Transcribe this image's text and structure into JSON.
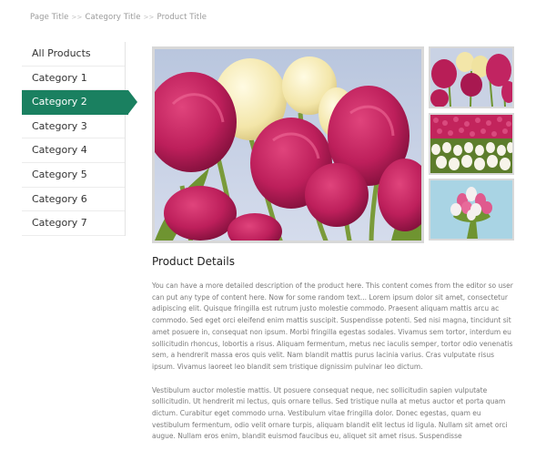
{
  "breadcrumb": {
    "items": [
      "Page Title",
      "Category Title",
      "Product Title"
    ],
    "separator": ">>"
  },
  "sidebar": {
    "items": [
      {
        "label": "All Products",
        "active": false
      },
      {
        "label": "Category 1",
        "active": false
      },
      {
        "label": "Category 2",
        "active": true
      },
      {
        "label": "Category 3",
        "active": false
      },
      {
        "label": "Category 4",
        "active": false
      },
      {
        "label": "Category 5",
        "active": false
      },
      {
        "label": "Category 6",
        "active": false
      },
      {
        "label": "Category 7",
        "active": false
      }
    ],
    "accent_color": "#1a8060"
  },
  "gallery": {
    "main_image": "tulips-closeup-image",
    "thumbnails": [
      "tulips-field-thumbnail",
      "tulips-rows-thumbnail",
      "tulips-bouquet-thumbnail"
    ]
  },
  "details": {
    "title": "Product Details",
    "paragraphs": [
      "You can have a more detailed description of the product here. This content comes from the editor so user can put any type of content here. Now for some random text... Lorem ipsum dolor sit amet, consectetur adipiscing elit. Quisque fringilla est rutrum justo molestie commodo. Praesent aliquam mattis arcu ac commodo. Sed eget orci eleifend enim mattis suscipit. Suspendisse potenti. Sed nisi magna, tincidunt sit amet posuere in, consequat non ipsum. Morbi fringilla egestas sodales. Vivamus sem tortor, interdum eu sollicitudin rhoncus, lobortis a risus. Aliquam fermentum, metus nec iaculis semper, tortor odio venenatis sem, a hendrerit massa eros quis velit. Nam blandit mattis purus lacinia varius. Cras vulputate risus ipsum. Vivamus laoreet leo blandit sem tristique dignissim pulvinar leo dictum.",
      "Vestibulum auctor molestie mattis. Ut posuere consequat neque, nec sollicitudin sapien vulputate sollicitudin. Ut hendrerit mi lectus, quis ornare tellus. Sed tristique nulla at metus auctor et porta quam dictum. Curabitur eget commodo urna. Vestibulum vitae fringilla dolor. Donec egestas, quam eu vestibulum fermentum, odio velit ornare turpis, aliquam blandit elit lectus id ligula. Nullam sit amet orci augue. Nullam eros enim, blandit euismod faucibus eu, aliquet sit amet risus. Suspendisse"
    ]
  }
}
